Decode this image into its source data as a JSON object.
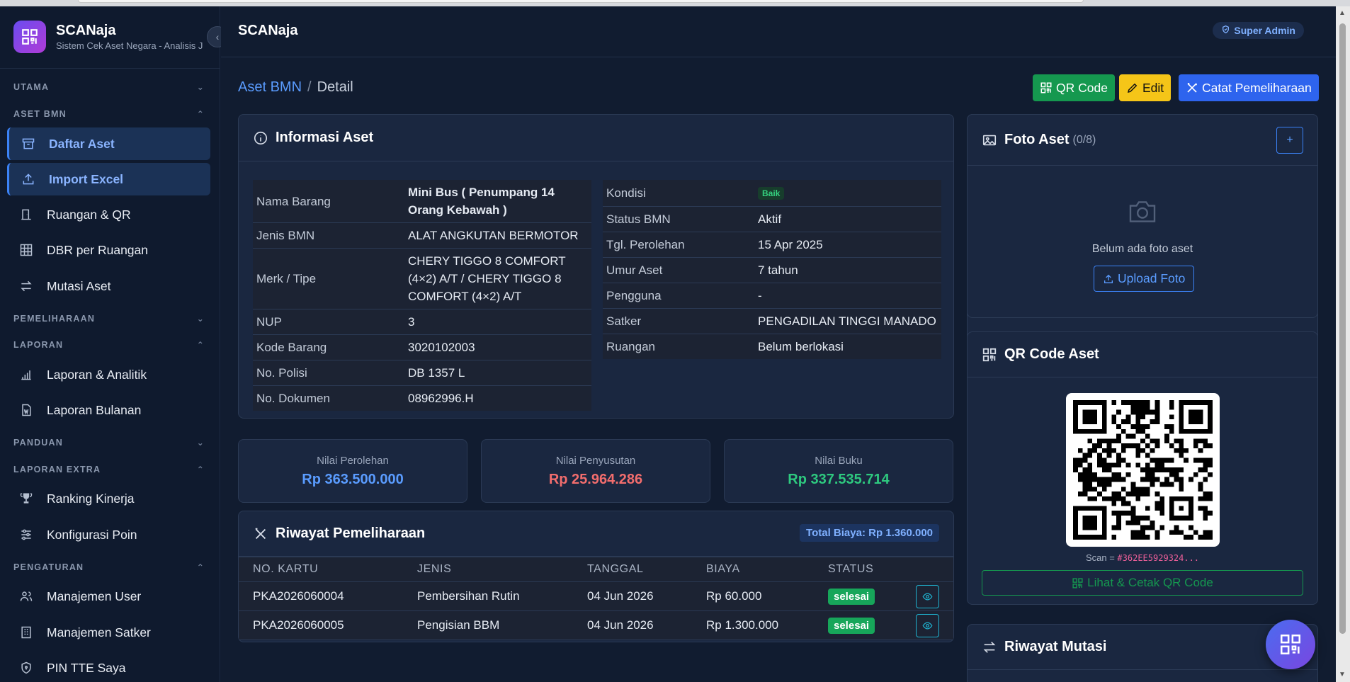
{
  "brand": {
    "title": "SCANaja",
    "subtitle": "Sistem Cek Aset Negara - Analisis J"
  },
  "sidebar": {
    "sections": {
      "utama": "UTAMA",
      "aset_bmn": "ASET BMN",
      "pemeliharaan": "PEMELIHARAAN",
      "laporan": "LAPORAN",
      "panduan": "PANDUAN",
      "laporan_extra": "LAPORAN EXTRA",
      "pengaturan": "PENGATURAN"
    },
    "items": {
      "daftar_aset": "Daftar Aset",
      "import_excel": "Import Excel",
      "ruangan_qr": "Ruangan & QR",
      "dbr": "DBR per Ruangan",
      "mutasi": "Mutasi Aset",
      "laporan_analitik": "Laporan & Analitik",
      "laporan_bulanan": "Laporan Bulanan",
      "ranking": "Ranking Kinerja",
      "konfigurasi": "Konfigurasi Poin",
      "manajemen_user": "Manajemen User",
      "manajemen_satker": "Manajemen Satker",
      "pin_tte": "PIN TTE Saya"
    }
  },
  "topbar": {
    "title": "SCANaja",
    "role": "Super Admin"
  },
  "breadcrumb": {
    "parent": "Aset BMN",
    "separator": "/",
    "current": "Detail"
  },
  "actions": {
    "qr": "QR Code",
    "edit": "Edit",
    "catat": "Catat Pemeliharaan"
  },
  "info": {
    "title": "Informasi Aset",
    "left": [
      {
        "k": "Nama Barang",
        "v": "Mini Bus ( Penumpang 14 Orang Kebawah )"
      },
      {
        "k": "Jenis BMN",
        "v": "ALAT ANGKUTAN BERMOTOR"
      },
      {
        "k": "Merk / Tipe",
        "v": "CHERY TIGGO 8 COMFORT (4×2) A/T / CHERY TIGGO 8 COMFORT (4×2) A/T"
      },
      {
        "k": "NUP",
        "v": "3"
      },
      {
        "k": "Kode Barang",
        "v": "3020102003"
      },
      {
        "k": "No. Polisi",
        "v": "DB 1357 L"
      },
      {
        "k": "No. Dokumen",
        "v": "08962996.H"
      }
    ],
    "right": [
      {
        "k": "Kondisi",
        "v": "Baik"
      },
      {
        "k": "Status BMN",
        "v": "Aktif"
      },
      {
        "k": "Tgl. Perolehan",
        "v": "15 Apr 2025"
      },
      {
        "k": "Umur Aset",
        "v": "7 tahun"
      },
      {
        "k": "Pengguna",
        "v": "-"
      },
      {
        "k": "Satker",
        "v": "PENGADILAN TINGGI MANADO"
      },
      {
        "k": "Ruangan",
        "v": "Belum berlokasi"
      }
    ]
  },
  "values": {
    "perolehan": {
      "label": "Nilai Perolehan",
      "value": "Rp 363.500.000"
    },
    "penyusutan": {
      "label": "Nilai Penyusutan",
      "value": "Rp 25.964.286"
    },
    "buku": {
      "label": "Nilai Buku",
      "value": "Rp 337.535.714"
    }
  },
  "history": {
    "title": "Riwayat Pemeliharaan",
    "total": "Total Biaya: Rp 1.360.000",
    "columns": [
      "NO. KARTU",
      "JENIS",
      "TANGGAL",
      "BIAYA",
      "STATUS"
    ],
    "rows": [
      {
        "kartu": "PKA2026060004",
        "jenis": "Pembersihan Rutin",
        "tanggal": "04 Jun 2026",
        "biaya": "Rp 60.000",
        "status": "selesai"
      },
      {
        "kartu": "PKA2026060005",
        "jenis": "Pengisian BBM",
        "tanggal": "04 Jun 2026",
        "biaya": "Rp 1.300.000",
        "status": "selesai"
      }
    ]
  },
  "foto": {
    "title": "Foto Aset",
    "count": "(0/8)",
    "add": "+",
    "empty": "Belum ada foto aset",
    "upload": "Upload Foto"
  },
  "qr": {
    "title": "QR Code Aset",
    "scan_prefix": "Scan = ",
    "scan_code": "#362EE5929324...",
    "button": "Lihat & Cetak QR Code"
  },
  "mutasi": {
    "title": "Riwayat Mutasi"
  },
  "colors": {
    "accent": "#3b82f6",
    "success": "#17a65a",
    "warning": "#f5c518",
    "danger": "#f26d6d",
    "bg": "#0f1a2e"
  }
}
